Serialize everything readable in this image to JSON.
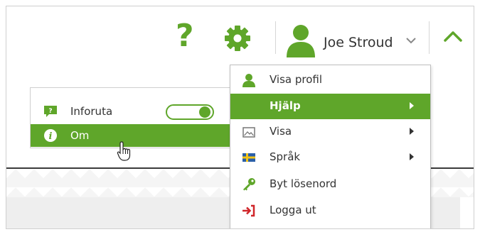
{
  "header": {
    "help_glyph": "?",
    "user_name": "Joe Stroud",
    "icons": [
      "help-icon",
      "gear-icon",
      "user-avatar-icon",
      "chevron-down-icon",
      "chevron-up-icon"
    ]
  },
  "popover": {
    "items": [
      {
        "label": "Inforuta",
        "icon": "info-panel-icon",
        "toggle_on": true
      },
      {
        "label": "Om",
        "icon": "info-icon"
      }
    ],
    "info_panel_glyph": "?",
    "info_glyph": "i"
  },
  "user_menu": {
    "items": [
      {
        "label": "Visa profil",
        "icon": "user-icon"
      },
      {
        "label": "Hjälp",
        "icon": "",
        "submenu": true
      },
      {
        "label": "Visa",
        "icon": "image-icon",
        "submenu": true
      },
      {
        "label": "Språk",
        "icon": "swedish-flag-icon",
        "submenu": true
      },
      {
        "label": "Byt lösenord",
        "icon": "key-icon"
      },
      {
        "label": "Logga ut",
        "icon": "logout-icon"
      }
    ]
  },
  "colors": {
    "accent": "#5fa62a",
    "text": "#333333",
    "logout_red": "#d0262a"
  }
}
